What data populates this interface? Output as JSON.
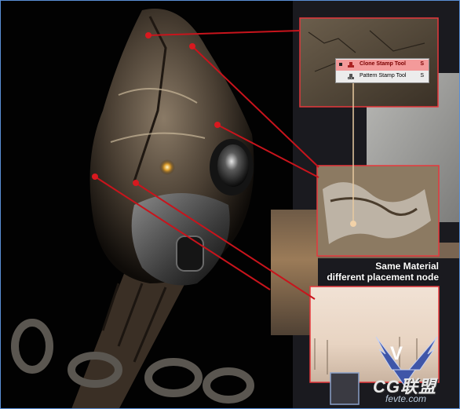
{
  "tool_menu": {
    "items": [
      {
        "label": "Clone Stamp Tool",
        "shortcut": "S",
        "icon": "clone-stamp-icon",
        "selected": true
      },
      {
        "label": "Pattern Stamp Tool",
        "shortcut": "S",
        "icon": "pattern-stamp-icon",
        "selected": false
      }
    ]
  },
  "caption": {
    "line1": "Same Material",
    "line2": "different placement node"
  },
  "watermark": {
    "logo_letter": "V",
    "logo_text": "CG联盟",
    "site": "fevte.com"
  },
  "colors": {
    "callout_red": "#c8141c",
    "frame_border": "#e6383c",
    "border_blue": "#5a8fd6"
  }
}
